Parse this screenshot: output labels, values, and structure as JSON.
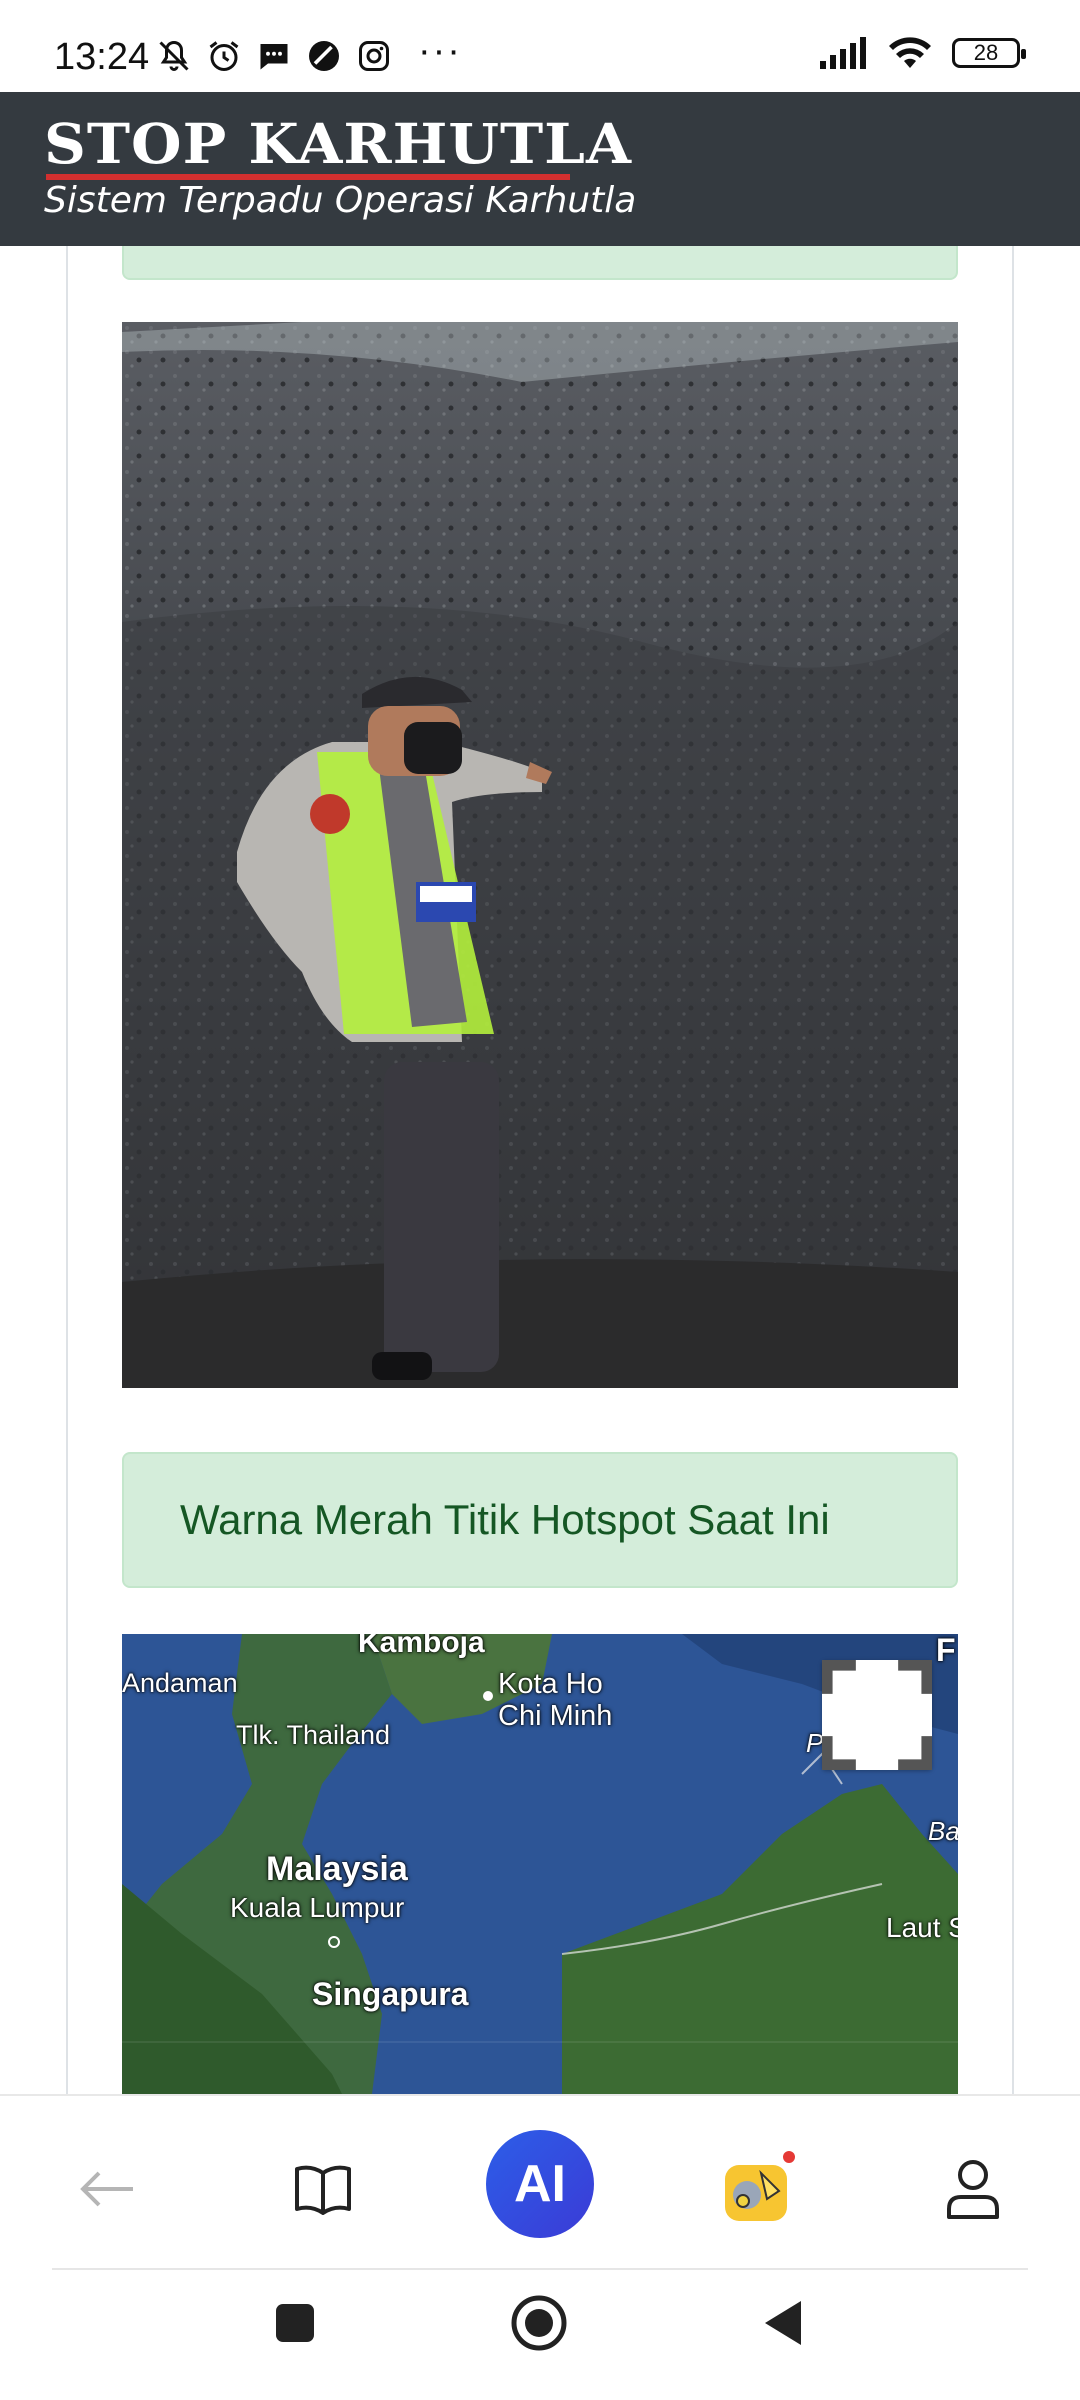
{
  "status_bar": {
    "time": "13:24",
    "battery": "28",
    "more": "···",
    "icons": [
      "mute-bell-icon",
      "alarm-icon",
      "message-icon",
      "no-disturb-icon",
      "instagram-icon",
      "signal-icon",
      "wifi-icon",
      "battery-icon"
    ]
  },
  "header": {
    "title": "STOP KARHUTLA",
    "subtitle": "Sistem Terpadu Operasi Karhutla",
    "accent_color": "#d32f2f",
    "background": "#343a40"
  },
  "alert": {
    "text": "Warna Merah Titik Hotspot Saat Ini",
    "background": "#d4edda",
    "color": "#155724"
  },
  "map": {
    "labels": {
      "kamboja": "Kamboja",
      "andaman": "Andaman",
      "kota_ho_chi_minh_1": "Kota Ho",
      "kota_ho_chi_minh_2": "Chi Minh",
      "tlk_thailand": "Tlk. Thailand",
      "malaysia": "Malaysia",
      "kuala_lumpur": "Kuala Lumpur",
      "singapura": "Singapura",
      "laut": "Laut S",
      "ba": "Ba",
      "p": "P",
      "f": "F"
    },
    "controls": [
      "fullscreen-icon"
    ]
  },
  "browser_nav": {
    "ai_label": "AI",
    "items": [
      "back-arrow-icon",
      "book-icon",
      "ai-button",
      "game-icon",
      "profile-icon"
    ]
  },
  "android_nav": {
    "items": [
      "recent-apps-icon",
      "home-icon",
      "back-icon"
    ]
  }
}
